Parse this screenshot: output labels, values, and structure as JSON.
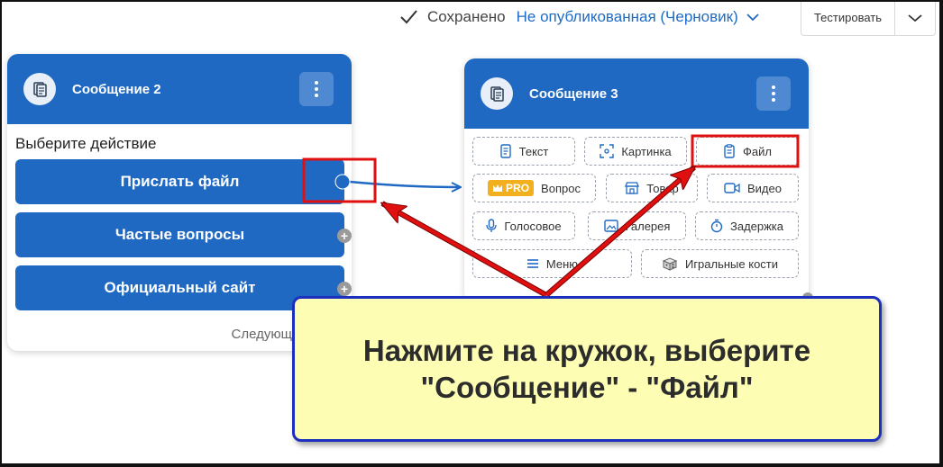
{
  "topbar": {
    "saved": "Сохранено",
    "status": "Не опубликованная (Черновик)",
    "test_button": "Тестировать"
  },
  "card1": {
    "title": "Сообщение 2",
    "choose_label": "Выберите действие",
    "buttons": [
      "Прислать файл",
      "Частые вопросы",
      "Официальный сайт"
    ],
    "next_label": "Следующ"
  },
  "card2": {
    "title": "Сообщение 3",
    "options": {
      "text": "Текст",
      "image": "Картинка",
      "file": "Файл",
      "pro": "PRO",
      "question": "Вопрос",
      "goods": "Товар",
      "video": "Видео",
      "voice": "Голосовое",
      "gallery": "Галерея",
      "delay": "Задержка",
      "menu": "Меню",
      "dice": "Игральные кости"
    }
  },
  "callout": {
    "text": "Нажмите на кружок, выберите\n\"Сообщение\" - \"Файл\""
  },
  "colors": {
    "primary": "#1f69c3",
    "highlight": "#e01010",
    "callout_bg": "#fefdb4",
    "callout_border": "#1d2fbf",
    "pro": "#f2b01e"
  }
}
